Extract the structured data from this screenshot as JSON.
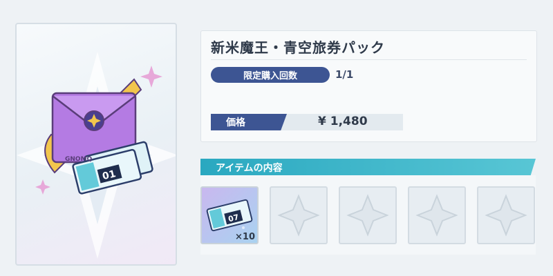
{
  "product": {
    "title": "新米魔王・青空旅券パック",
    "limit_label": "限定購入回数",
    "limit_value": "1/1",
    "price_label": "価格",
    "price_value": "¥ 1,480",
    "envelope_text": "GNOMQ",
    "ticket_number": "01"
  },
  "contents": {
    "header": "アイテムの内容",
    "items": [
      {
        "name": "ticket",
        "quantity": "×10",
        "ticket_number": "07"
      },
      {
        "name": "empty"
      },
      {
        "name": "empty"
      },
      {
        "name": "empty"
      },
      {
        "name": "empty"
      }
    ]
  },
  "colors": {
    "accent_navy": "#3d5593",
    "accent_teal": "#2aa8c0",
    "envelope_purple": "#a46ad9"
  }
}
